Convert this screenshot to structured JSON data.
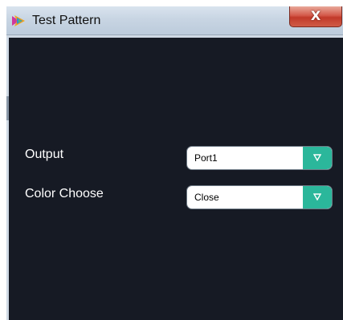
{
  "window": {
    "title": "Test Pattern",
    "close_label": "X"
  },
  "form": {
    "output": {
      "label": "Output",
      "value": "Port1"
    },
    "color_choose": {
      "label": "Color Choose",
      "value": "Close"
    }
  },
  "icons": {
    "app": "app-logo-icon",
    "close": "close-icon",
    "dropdown": "chevron-down-icon"
  },
  "colors": {
    "panel_background": "#161a24",
    "dropdown_accent": "#2bb79b",
    "close_button": "#c23a2a"
  }
}
